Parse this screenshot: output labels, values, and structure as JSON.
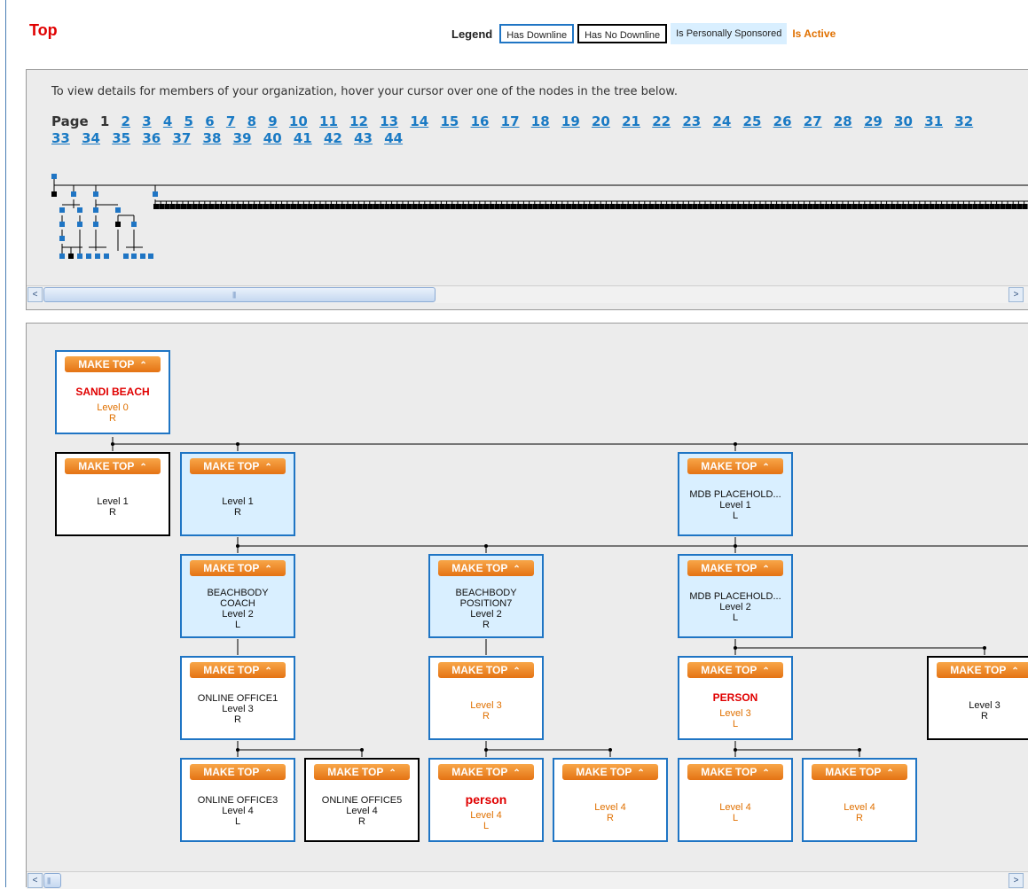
{
  "title": "Top",
  "legend": {
    "label": "Legend",
    "has_downline": "Has Downline",
    "has_no_downline": "Has No Downline",
    "personally_sponsored": "Is Personally Sponsored",
    "is_active": "Is Active"
  },
  "instructions": "To view details for members of your organization, hover your cursor over one of the nodes in the tree below.",
  "pager": {
    "label": "Page",
    "current": "1",
    "pages": [
      "2",
      "3",
      "4",
      "5",
      "6",
      "7",
      "8",
      "9",
      "10",
      "11",
      "12",
      "13",
      "14",
      "15",
      "16",
      "17",
      "18",
      "19",
      "20",
      "21",
      "22",
      "23",
      "24",
      "25",
      "26",
      "27",
      "28",
      "29",
      "30",
      "31",
      "32",
      "33",
      "34",
      "35",
      "36",
      "37",
      "38",
      "39",
      "40",
      "41",
      "42",
      "43",
      "44"
    ]
  },
  "make_top_label": "MAKE TOP",
  "scroll": {
    "left_arrow": "<",
    "right_arrow": ">",
    "grip": "|||"
  },
  "nodes": [
    {
      "name": "SANDI BEACH",
      "level": "Level 0",
      "side": "R",
      "downline": true,
      "sponsored": false,
      "active": true
    },
    {
      "name": "",
      "level": "Level 1",
      "side": "R",
      "downline": false,
      "sponsored": false,
      "active": false
    },
    {
      "name": "",
      "level": "Level 1",
      "side": "R",
      "downline": true,
      "sponsored": true,
      "active": false
    },
    {
      "name": "MDB PLACEHOLD...",
      "level": "Level 1",
      "side": "L",
      "downline": true,
      "sponsored": true,
      "active": false
    },
    {
      "name": "BEACHBODY COACH",
      "level": "Level 2",
      "side": "L",
      "downline": true,
      "sponsored": true,
      "active": false
    },
    {
      "name": "BEACHBODY POSITION7",
      "level": "Level 2",
      "side": "R",
      "downline": true,
      "sponsored": true,
      "active": false
    },
    {
      "name": "MDB PLACEHOLD...",
      "level": "Level 2",
      "side": "L",
      "downline": true,
      "sponsored": true,
      "active": false
    },
    {
      "name": "ONLINE OFFICE1",
      "level": "Level 3",
      "side": "R",
      "downline": true,
      "sponsored": false,
      "active": false
    },
    {
      "name": "",
      "level": "Level 3",
      "side": "R",
      "downline": true,
      "sponsored": false,
      "active": true
    },
    {
      "name": "PERSON",
      "level": "Level 3",
      "side": "L",
      "downline": true,
      "sponsored": false,
      "active": true
    },
    {
      "name": "",
      "level": "Level 3",
      "side": "R",
      "downline": false,
      "sponsored": false,
      "active": false
    },
    {
      "name": "ONLINE OFFICE3",
      "level": "Level 4",
      "side": "L",
      "downline": true,
      "sponsored": false,
      "active": false
    },
    {
      "name": "ONLINE OFFICE5",
      "level": "Level 4",
      "side": "R",
      "downline": false,
      "sponsored": false,
      "active": false
    },
    {
      "name": "person",
      "level": "Level 4",
      "side": "L",
      "downline": true,
      "sponsored": false,
      "active": true
    },
    {
      "name": "",
      "level": "Level 4",
      "side": "R",
      "downline": true,
      "sponsored": false,
      "active": true
    },
    {
      "name": "",
      "level": "Level 4",
      "side": "L",
      "downline": true,
      "sponsored": false,
      "active": true
    },
    {
      "name": "",
      "level": "Level 4",
      "side": "R",
      "downline": true,
      "sponsored": false,
      "active": true
    }
  ],
  "colors": {
    "downline_border": "#1f75c4",
    "no_downline_border": "#000000",
    "sponsored_bg": "#d9efff",
    "active_text": "#e07000",
    "title_red": "#e00000",
    "make_top_orange": "#f08a24",
    "link_blue": "#1a7ac4"
  }
}
